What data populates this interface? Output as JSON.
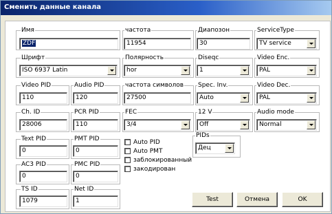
{
  "window": {
    "title": "Сменить данные канала"
  },
  "fields": {
    "name": {
      "label": "Имя",
      "value": "ZDF"
    },
    "frequency": {
      "label": "частота",
      "value": "11954"
    },
    "range": {
      "label": "Диапозон",
      "value": "30"
    },
    "service_type": {
      "label": "ServiceType",
      "value": "TV service"
    },
    "font": {
      "label": "Шрифт",
      "value": "ISO 6937 Latin"
    },
    "polarity": {
      "label": "Полярность",
      "value": "hor"
    },
    "diseqc": {
      "label": "Diseqc",
      "value": "1"
    },
    "video_enc": {
      "label": "Video Enc.",
      "value": "PAL"
    },
    "video_pid": {
      "label": "Video PID",
      "value": "110"
    },
    "audio_pid": {
      "label": "Audio PID",
      "value": "120"
    },
    "symbol_rate": {
      "label": "частота символов",
      "value": "27500"
    },
    "spec_inv": {
      "label": "Spec. Inv.",
      "value": "Auto"
    },
    "video_dec": {
      "label": "Video Dec.",
      "value": "PAL"
    },
    "ch_id": {
      "label": "Ch. ID",
      "value": "28006"
    },
    "pcr_pid": {
      "label": "PCR PID",
      "value": "110"
    },
    "fec": {
      "label": "FEC",
      "value": "3/4"
    },
    "v12": {
      "label": "12 V",
      "value": "Off"
    },
    "audio_mode": {
      "label": "Audio mode",
      "value": "Normal"
    },
    "text_pid": {
      "label": "Text PID",
      "value": "0"
    },
    "pmt_pid": {
      "label": "PMT PID",
      "value": "0"
    },
    "ac3_pid": {
      "label": "AC3 PID",
      "value": "0"
    },
    "pmc_pid": {
      "label": "PMC PID",
      "value": "0"
    },
    "ts_id": {
      "label": "TS ID",
      "value": "1079"
    },
    "net_id": {
      "label": "Net ID",
      "value": "1"
    },
    "pids": {
      "label": "PIDs",
      "value": "Дец"
    }
  },
  "checkboxes": {
    "auto_pid": {
      "label": "Auto PID",
      "checked": false
    },
    "auto_pmt": {
      "label": "Auto PMT",
      "checked": false
    },
    "locked": {
      "label": "заблокированный",
      "checked": false
    },
    "encrypted": {
      "label": "закодирован",
      "checked": false
    }
  },
  "buttons": {
    "test": "Test",
    "cancel": "Отмена",
    "ok": "OK"
  }
}
